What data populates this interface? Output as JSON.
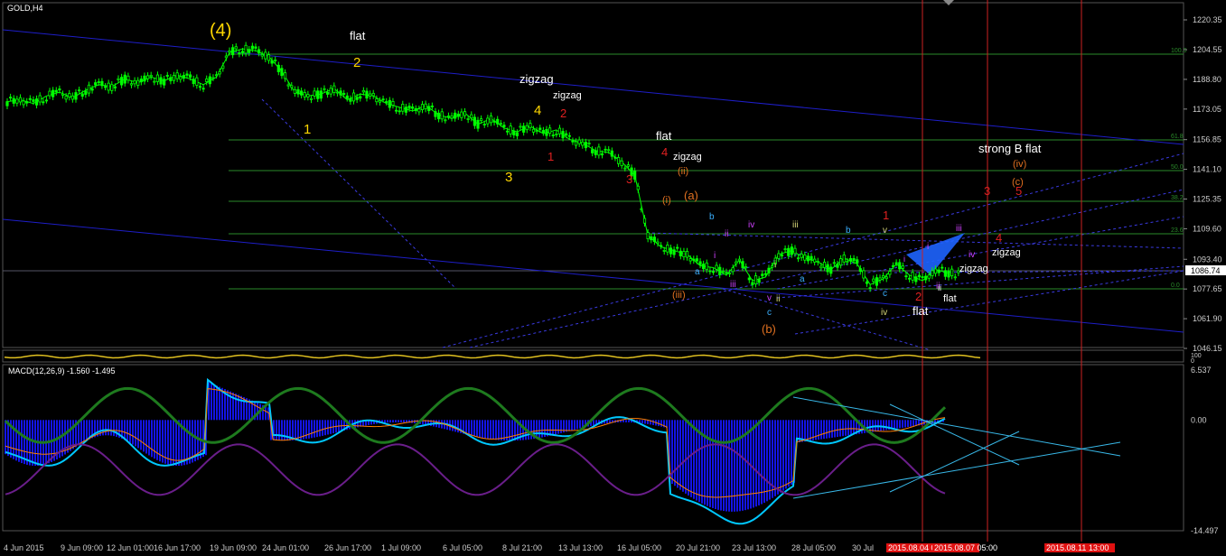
{
  "symbol": "GOLD,H4",
  "indicator_label": "MACD(12,26,9) -1.560 -1.495",
  "price_label": "1086.74",
  "time_labels": [
    "4 Jun 2015",
    "9 Jun 09:00",
    "12 Jun 01:00",
    "16 Jun 17:00",
    "19 Jun 09:00",
    "24 Jun 01:00",
    "26 Jun 17:00",
    "1 Jul 09:00",
    "6 Jul 05:00",
    "8 Jul 21:00",
    "13 Jul 13:00",
    "16 Jul 05:00",
    "20 Jul 21:00",
    "23 Jul 13:00",
    "28 Jul 05:00",
    "30 Jul"
  ],
  "future_time_labels": [
    "2015.08.04 05:00",
    "2015.08.07 05:00",
    "2015.08.11 13:00"
  ],
  "fib_labels": [
    "100.0",
    "61.8",
    "50.0",
    "38.2",
    "23.6",
    "0.0"
  ],
  "macd_ticks": [
    "6.537",
    "0.00",
    "-14.497"
  ],
  "sub_ticks": [
    "100",
    "0"
  ],
  "colors": {
    "bg": "#000000",
    "candle": "#00ff00",
    "trend": "#1e1ec8",
    "fib": "#2a8a2a",
    "vline": "#cc2222",
    "yellow": "#ffd700",
    "red": "#e02020",
    "white": "#ffffff",
    "orange": "#e07020",
    "macd_hist": "#1414e6",
    "macd_signal": "#ff8000",
    "cyan": "#00c8ff",
    "green_line": "#1e7a1e",
    "purple_line": "#6a1e8a"
  },
  "wave_labels": [
    {
      "text": "(4)",
      "color": "yellow"
    },
    {
      "text": "flat",
      "color": "white"
    },
    {
      "text": "2",
      "color": "yellow"
    },
    {
      "text": "zigzag",
      "color": "white"
    },
    {
      "text": "zigzag",
      "color": "white"
    },
    {
      "text": "4",
      "color": "yellow"
    },
    {
      "text": "2",
      "color": "red"
    },
    {
      "text": "1",
      "color": "yellow"
    },
    {
      "text": "3",
      "color": "yellow"
    },
    {
      "text": "1",
      "color": "red"
    },
    {
      "text": "flat",
      "color": "white"
    },
    {
      "text": "4",
      "color": "red"
    },
    {
      "text": "zigzag",
      "color": "white"
    },
    {
      "text": "3",
      "color": "red"
    },
    {
      "text": "(ii)",
      "color": "orange"
    },
    {
      "text": "(i)",
      "color": "orange"
    },
    {
      "text": "(a)",
      "color": "orange"
    },
    {
      "text": "(iii)",
      "color": "orange"
    },
    {
      "text": "(b)",
      "color": "orange"
    },
    {
      "text": "flat",
      "color": "white"
    },
    {
      "text": "2",
      "color": "red"
    },
    {
      "text": "1",
      "color": "red"
    },
    {
      "text": "strong B flat",
      "color": "white"
    },
    {
      "text": "(iv)",
      "color": "orange"
    },
    {
      "text": "(c)",
      "color": "orange"
    },
    {
      "text": "3",
      "color": "red"
    },
    {
      "text": "5",
      "color": "red"
    },
    {
      "text": "4",
      "color": "red"
    },
    {
      "text": "zigzag",
      "color": "white"
    },
    {
      "text": "zigzag",
      "color": "white"
    },
    {
      "text": "flat",
      "color": "white"
    },
    {
      "text": "b",
      "color": "cyan"
    },
    {
      "text": "a",
      "color": "cyan"
    },
    {
      "text": "c",
      "color": "cyan"
    },
    {
      "text": "b",
      "color": "cyan"
    },
    {
      "text": "a",
      "color": "cyan"
    },
    {
      "text": "c",
      "color": "cyan"
    },
    {
      "text": "iv",
      "color": "magenta"
    },
    {
      "text": "ii",
      "color": "magenta"
    },
    {
      "text": "iii",
      "color": "magenta"
    },
    {
      "text": "v",
      "color": "magenta"
    },
    {
      "text": "i",
      "color": "magenta"
    },
    {
      "text": "iii",
      "color": "yellowish"
    },
    {
      "text": "v",
      "color": "yellowish"
    },
    {
      "text": "ii",
      "color": "yellowish"
    },
    {
      "text": "i",
      "color": "yellowish"
    },
    {
      "text": "iv",
      "color": "yellowish"
    },
    {
      "text": "iii",
      "color": "magenta"
    },
    {
      "text": "i",
      "color": "magenta"
    },
    {
      "text": "iv",
      "color": "magenta"
    },
    {
      "text": "ii",
      "color": "magenta"
    },
    {
      "text": "i",
      "color": "magenta"
    },
    {
      "text": "ii",
      "color": "white"
    }
  ],
  "chart_data": {
    "type": "line",
    "title": "GOLD,H4",
    "subtitle": "",
    "ylim": [
      1046.15,
      1220.35
    ],
    "y_ticks": [
      1220.35,
      1204.55,
      1188.8,
      1173.05,
      1156.85,
      1141.1,
      1125.35,
      1109.6,
      1093.4,
      1077.65,
      1061.9,
      1046.15
    ],
    "x_tick_labels": [
      "4 Jun 2015",
      "9 Jun 09:00",
      "12 Jun 01:00",
      "16 Jun 17:00",
      "19 Jun 09:00",
      "24 Jun 01:00",
      "26 Jun 17:00",
      "1 Jul 09:00",
      "6 Jul 05:00",
      "8 Jul 21:00",
      "13 Jul 13:00",
      "16 Jul 05:00",
      "20 Jul 21:00",
      "23 Jul 13:00",
      "28 Jul 05:00",
      "30 Jul"
    ],
    "current_price": 1086.74,
    "series": [
      {
        "name": "",
        "values": [
          1177,
          1178,
          1176,
          1180,
          1182,
          1179,
          1183,
          1186,
          1185,
          1189,
          1187,
          1190,
          1188,
          1191,
          1189,
          1186,
          1190,
          1203,
          1205,
          1204,
          1201,
          1193,
          1182,
          1180,
          1181,
          1184,
          1178,
          1181,
          1180,
          1176,
          1174,
          1172,
          1175,
          1170,
          1168,
          1171,
          1165,
          1168,
          1163,
          1161,
          1164,
          1160,
          1162,
          1157,
          1155,
          1151,
          1150,
          1145,
          1138,
          1106,
          1100,
          1098,
          1096,
          1090,
          1089,
          1085,
          1093,
          1082,
          1084,
          1096,
          1098,
          1094,
          1092,
          1088,
          1094,
          1091,
          1080,
          1083,
          1091,
          1085,
          1082,
          1088,
          1086
        ]
      }
    ],
    "fib_levels": [
      "100.0",
      "61.8",
      "50.0",
      "38.2",
      "23.6",
      "0.0"
    ],
    "indicators": [
      {
        "name": "MACD(12,26,9)",
        "values": [
          -1.56,
          -1.495
        ],
        "ylim": [
          -14.497,
          6.537
        ]
      }
    ]
  }
}
